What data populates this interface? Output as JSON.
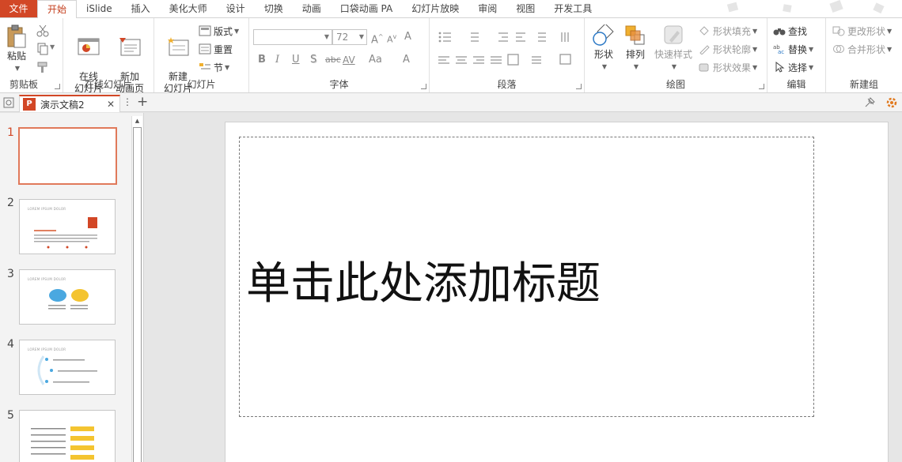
{
  "menu": {
    "tabs": [
      "文件",
      "开始",
      "iSlide",
      "插入",
      "美化大师",
      "设计",
      "切换",
      "动画",
      "口袋动画 PA",
      "幻灯片放映",
      "审阅",
      "视图",
      "开发工具"
    ],
    "active_index": 1
  },
  "ribbon": {
    "clipboard": {
      "label": "剪贴板",
      "paste": "粘贴"
    },
    "online_slides": {
      "label": "在线幻灯片",
      "online_slide": "在线\n幻灯片",
      "new_anim": "新加\n动画页"
    },
    "slides": {
      "label": "幻灯片",
      "new_slide": "新建\n幻灯片",
      "layout": "版式",
      "reset": "重置",
      "section": "节"
    },
    "font": {
      "label": "字体",
      "font_name": "",
      "font_size": "72",
      "clear": "A",
      "bold": "B",
      "italic": "I",
      "underline": "U",
      "shadow": "S",
      "strike": "abc",
      "spacing": "AV",
      "case": "Aa",
      "color": "A"
    },
    "paragraph": {
      "label": "段落"
    },
    "drawing": {
      "label": "绘图",
      "shapes": "形状",
      "arrange": "排列",
      "quick_styles": "快速样式",
      "fill": "形状填充",
      "outline": "形状轮廓",
      "effects": "形状效果"
    },
    "editing": {
      "label": "编辑",
      "find": "查找",
      "replace": "替换",
      "select": "选择"
    },
    "new_group": {
      "label": "新建组",
      "change_shape": "更改形状",
      "merge_shapes": "合并形状"
    }
  },
  "document": {
    "name": "演示文稿2"
  },
  "thumbnails": [
    {
      "num": "1",
      "lorem": ""
    },
    {
      "num": "2",
      "lorem": "LOREM IPSUM DOLOR"
    },
    {
      "num": "3",
      "lorem": "LOREM IPSUM DOLOR"
    },
    {
      "num": "4",
      "lorem": "LOREM IPSUM DOLOR"
    },
    {
      "num": "5",
      "lorem": ""
    }
  ],
  "slide": {
    "title_placeholder": "单击此处添加标题"
  },
  "colors": {
    "accent": "#d24726",
    "selection": "#e0795a"
  }
}
